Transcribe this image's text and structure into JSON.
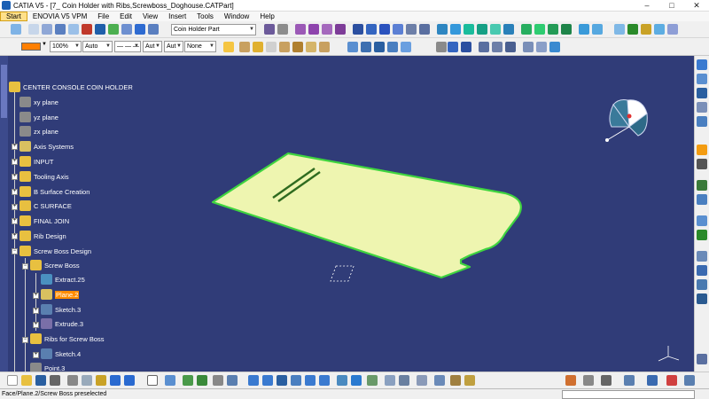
{
  "window": {
    "title": "CATIA V5 - [7_ Coin Holder with Ribs,Screwboss_Doghouse.CATPart]",
    "minimize": "–",
    "maximize": "□",
    "close": "✕"
  },
  "menu": {
    "items": [
      "Start",
      "ENOVIA V5 VPM",
      "File",
      "Edit",
      "View",
      "Insert",
      "Tools",
      "Window",
      "Help"
    ],
    "active_index": 0
  },
  "toolbar": {
    "part_combo": "Coin Holder Part",
    "zoom_combo": "100%",
    "linetype_combo": "Auto",
    "dash_combo": "— — — —",
    "thickness_combo": "Aut",
    "layer_combo": "Aut",
    "filter_combo": "None",
    "color_swatch": "#ff7f00"
  },
  "tree": {
    "root": "CENTER CONSOLE COIN HOLDER",
    "items": [
      {
        "label": "xy plane"
      },
      {
        "label": "yz plane"
      },
      {
        "label": "zx plane"
      },
      {
        "label": "Axis Systems"
      },
      {
        "label": "INPUT"
      },
      {
        "label": "Tooling Axis"
      },
      {
        "label": "B Surface Creation"
      },
      {
        "label": "C SURFACE"
      },
      {
        "label": "FINAL JOIN"
      },
      {
        "label": "Rib Design"
      },
      {
        "label": "Screw Boss Design"
      },
      {
        "label": "Screw Boss"
      },
      {
        "label": "Extract.25"
      },
      {
        "label": "Plane.2"
      },
      {
        "label": "Sketch.3"
      },
      {
        "label": "Extrude.3"
      },
      {
        "label": "Ribs for Screw Boss"
      },
      {
        "label": "Sketch.4"
      },
      {
        "label": "Point.3"
      }
    ]
  },
  "colors": {
    "viewport_bg": "#303c78",
    "part_fill": "#eef5b0",
    "part_edge": "#3fd43f",
    "selection": "#ff8c00"
  },
  "status": {
    "text": "Face/Plane.2/Screw Boss preselected"
  }
}
